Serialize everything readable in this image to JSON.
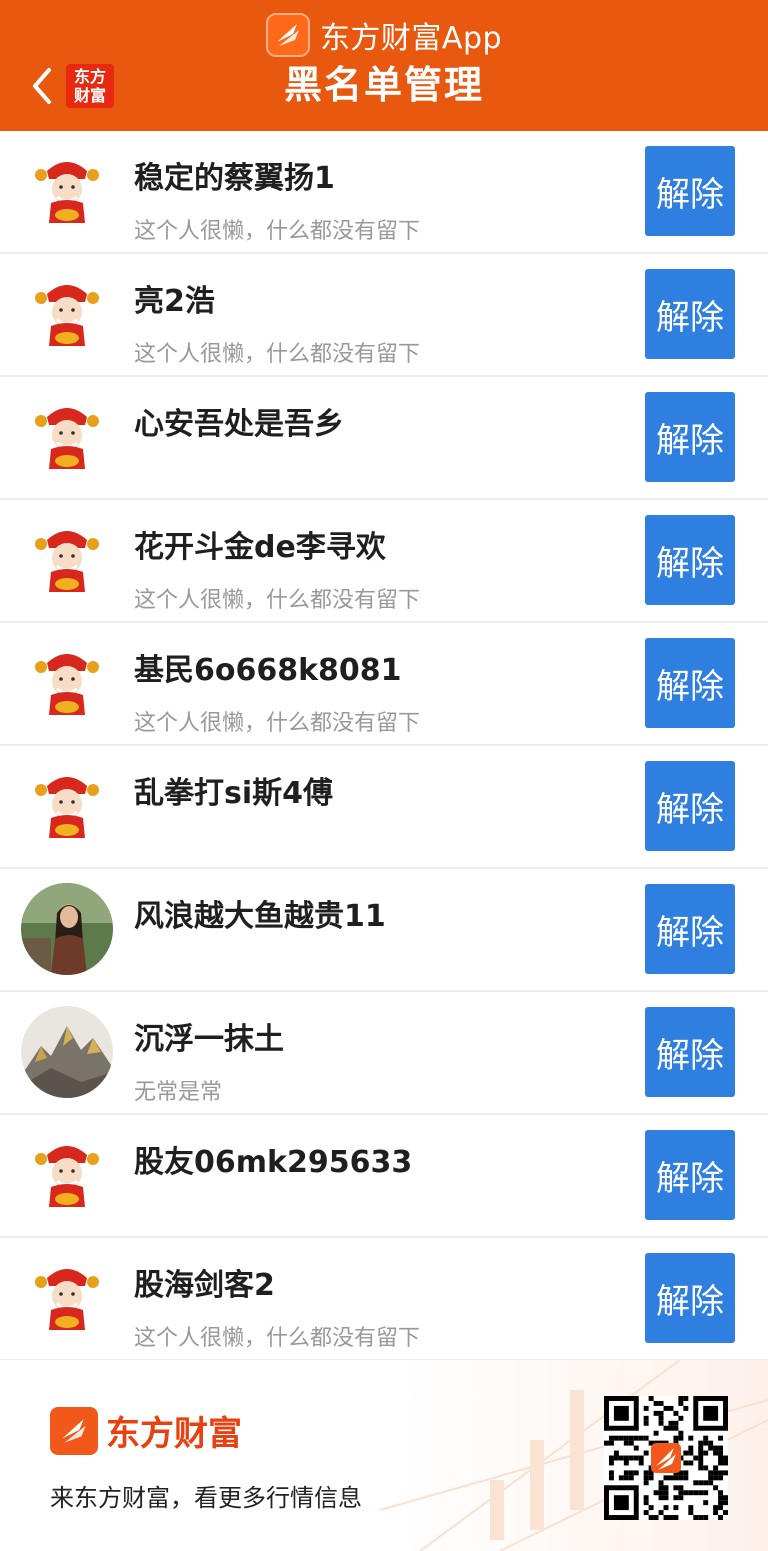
{
  "header": {
    "app_name": "东方财富App",
    "title": "黑名单管理",
    "mini_logo_line1": "东方",
    "mini_logo_line2": "财富",
    "bg_color": "#e8590f"
  },
  "blacklist": {
    "button_label": "解除",
    "users": [
      {
        "name": "稳定的蔡翼扬1",
        "desc": "这个人很懒，什么都没有留下",
        "avatar": "mascot"
      },
      {
        "name": "亮2浩",
        "desc": "这个人很懒，什么都没有留下",
        "avatar": "mascot"
      },
      {
        "name": "心安吾处是吾乡",
        "desc": "",
        "avatar": "mascot"
      },
      {
        "name": "花开斗金de李寻欢",
        "desc": "这个人很懒，什么都没有留下",
        "avatar": "mascot"
      },
      {
        "name": "基民6o668k8081",
        "desc": "这个人很懒，什么都没有留下",
        "avatar": "mascot"
      },
      {
        "name": "乱拳打si斯4傅",
        "desc": "",
        "avatar": "mascot"
      },
      {
        "name": "风浪越大鱼越贵11",
        "desc": "",
        "avatar": "photo-person"
      },
      {
        "name": "沉浮一抹土",
        "desc": "无常是常",
        "avatar": "photo-mountain"
      },
      {
        "name": "股友06mk295633",
        "desc": "",
        "avatar": "mascot"
      },
      {
        "name": "股海剑客2",
        "desc": "这个人很懒，什么都没有留下",
        "avatar": "mascot"
      }
    ]
  },
  "footer": {
    "brand": "东方财富",
    "slogan": "来东方财富，看更多行情信息"
  },
  "colors": {
    "accent": "#e8590f",
    "button": "#2f7fe0"
  }
}
